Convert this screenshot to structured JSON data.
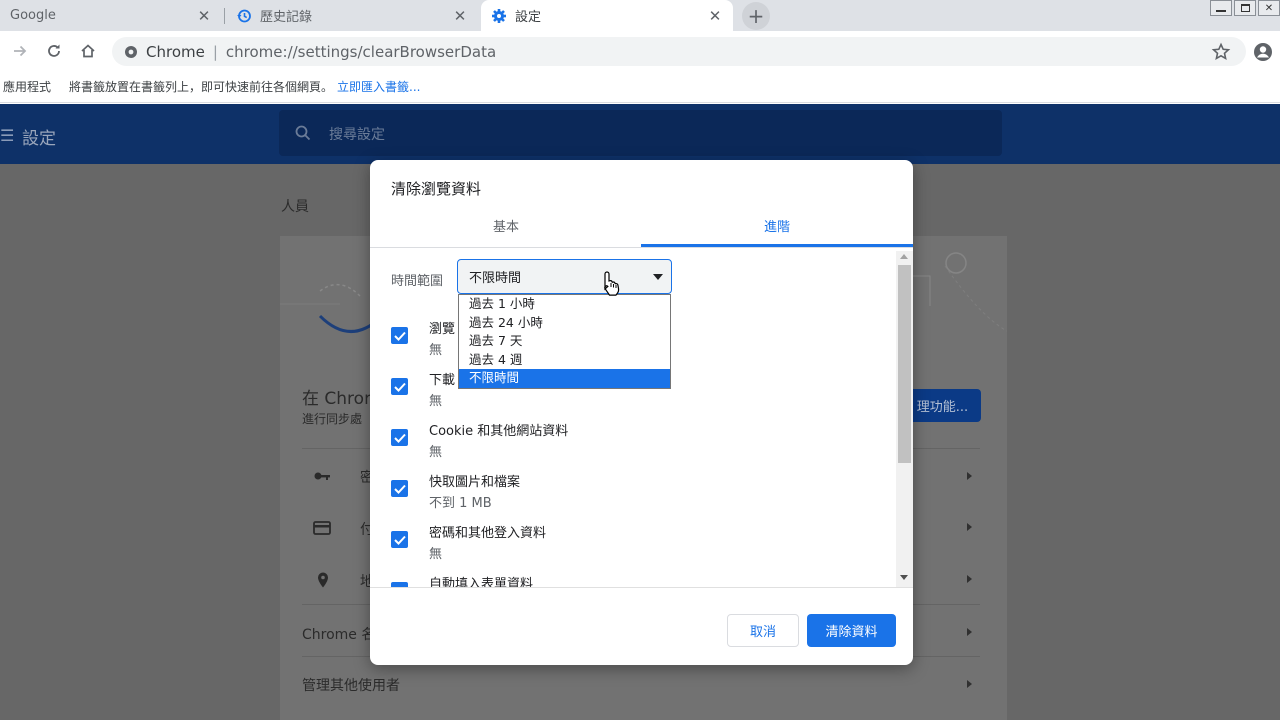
{
  "browser": {
    "tabs": [
      {
        "title": "Google",
        "active": false
      },
      {
        "title": "歷史記錄",
        "active": false
      },
      {
        "title": "設定",
        "active": true
      }
    ],
    "omnibox": {
      "site_label": "Chrome",
      "url": "chrome://settings/clearBrowserData"
    },
    "bookmarks_bar": {
      "apps": "應用程式",
      "hint": "將書籤放置在書籤列上，即可快速前往各個網頁。",
      "import_link": "立即匯入書籤..."
    }
  },
  "settings_page": {
    "header_title": "設定",
    "search_placeholder": "搜尋設定",
    "section_people": "人員",
    "sync_title_partial": "在 Chror",
    "sync_sub_partial": "進行同步處",
    "sync_button_partial": "理功能...",
    "row_passwords_partial": "密",
    "row_payments_partial": "付",
    "row_addresses_partial": "地",
    "row_chrome_name_partial": "Chrome 名",
    "row_manage_users": "管理其他使用者"
  },
  "dialog": {
    "title": "清除瀏覽資料",
    "tabs": [
      {
        "label": "基本",
        "active": false
      },
      {
        "label": "進階",
        "active": true
      }
    ],
    "time_range": {
      "label": "時間範圍",
      "selected": "不限時間",
      "options": [
        "過去 1 小時",
        "過去 24 小時",
        "過去 7 天",
        "過去 4 週",
        "不限時間"
      ]
    },
    "items": [
      {
        "label": "瀏覽",
        "sub": "無",
        "checked": true
      },
      {
        "label": "下載",
        "sub": "無",
        "checked": true
      },
      {
        "label": "Cookie 和其他網站資料",
        "sub": "無",
        "checked": true
      },
      {
        "label": "快取圖片和檔案",
        "sub": "不到 1 MB",
        "checked": true
      },
      {
        "label": "密碼和其他登入資料",
        "sub": "無",
        "checked": true
      },
      {
        "label": "自動填入表單資料",
        "sub": "",
        "checked": true
      }
    ],
    "cancel_label": "取消",
    "clear_label": "清除資料"
  },
  "colors": {
    "accent": "#1a73e8",
    "settings_header": "#0e3168",
    "overlay": "#676767"
  }
}
